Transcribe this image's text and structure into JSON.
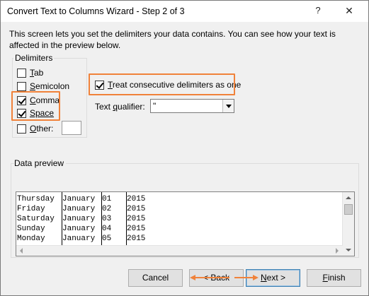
{
  "window": {
    "title": "Convert Text to Columns Wizard - Step 2 of 3",
    "help_glyph": "?",
    "close_glyph": "✕"
  },
  "intro_text": "This screen lets you set the delimiters your data contains.  You can see how your text is affected in the preview below.",
  "delimiters": {
    "legend": "Delimiters",
    "items": [
      {
        "hot": "T",
        "rest": "ab",
        "checked": false
      },
      {
        "hot": "S",
        "rest": "emicolon",
        "checked": false
      },
      {
        "hot": "C",
        "rest": "omma",
        "checked": true
      },
      {
        "hot": "Space",
        "rest": "",
        "checked": true
      },
      {
        "hot": "O",
        "rest": "ther:",
        "checked": false
      }
    ],
    "other_value": ""
  },
  "consecutive": {
    "pre": "",
    "hot": "T",
    "rest": "reat consecutive delimiters as one",
    "checked": true
  },
  "text_qualifier": {
    "label_pre": "Text ",
    "label_hot": "q",
    "label_rest": "ualifier:",
    "value": "\""
  },
  "preview": {
    "label": "Data preview",
    "rows": [
      [
        "Thursday ",
        "January",
        "01",
        "2015"
      ],
      [
        "Friday   ",
        "January",
        "02",
        "2015"
      ],
      [
        "Saturday ",
        "January",
        "03",
        "2015"
      ],
      [
        "Sunday   ",
        "January",
        "04",
        "2015"
      ],
      [
        "Monday   ",
        "January",
        "05",
        "2015"
      ]
    ]
  },
  "buttons": {
    "cancel": "Cancel",
    "back": "< Back",
    "next_hot": "N",
    "next_rest": "ext >",
    "finish_hot": "F",
    "finish_rest": "inish"
  },
  "colors": {
    "highlight": "#f0823a",
    "dialog_bg": "#f0f0f0"
  }
}
